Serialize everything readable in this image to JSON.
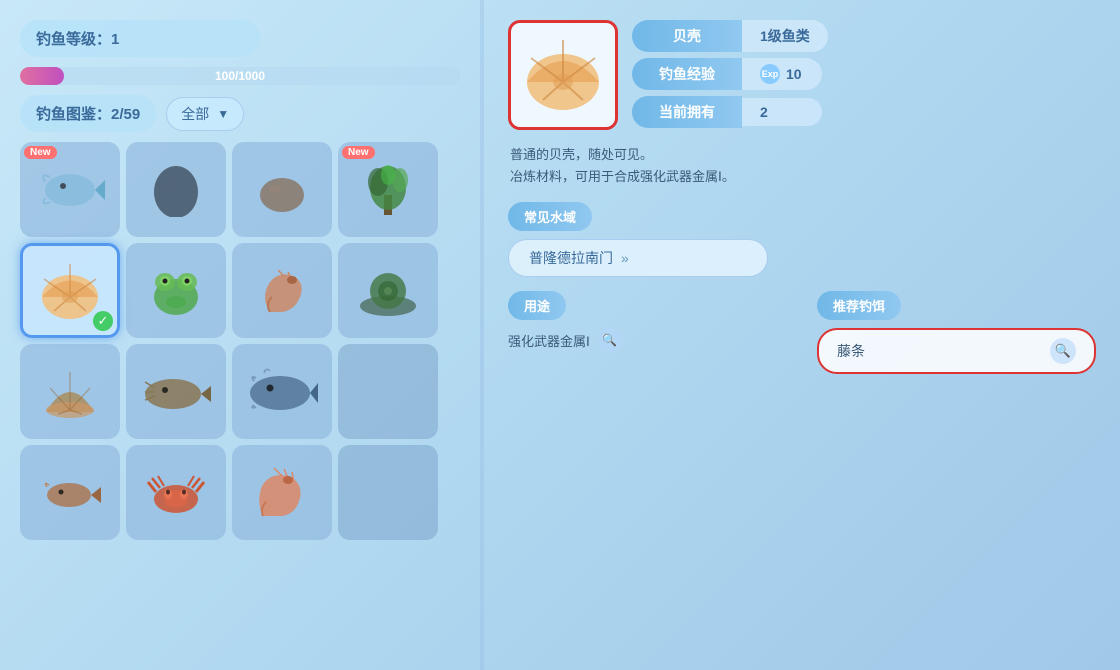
{
  "left": {
    "fishing_level_label": "钓鱼等级：1",
    "exp_current": "100",
    "exp_max": "1000",
    "exp_bar_text": "100/1000",
    "exp_percent": 10,
    "encyclopedia_label": "钓鱼图鉴：2/59",
    "filter_label": "全部",
    "grid": [
      {
        "id": 0,
        "has_new": true,
        "has_fish": true,
        "fish_type": "fish",
        "color": "#aaccee",
        "selected": false,
        "discovered": true
      },
      {
        "id": 1,
        "has_new": false,
        "has_fish": true,
        "fish_type": "egg",
        "color": "#778899",
        "selected": false,
        "discovered": true
      },
      {
        "id": 2,
        "has_new": false,
        "has_fish": true,
        "fish_type": "rock",
        "color": "#998877",
        "selected": false,
        "discovered": true
      },
      {
        "id": 3,
        "has_new": true,
        "has_fish": true,
        "fish_type": "plant",
        "color": "#558855",
        "selected": false,
        "discovered": true
      },
      {
        "id": 4,
        "has_new": false,
        "has_fish": true,
        "fish_type": "shell",
        "color": "#eebb88",
        "selected": true,
        "discovered": true,
        "checked": true
      },
      {
        "id": 5,
        "has_new": false,
        "has_fish": true,
        "fish_type": "frog",
        "color": "#55aa55",
        "selected": false,
        "discovered": true
      },
      {
        "id": 6,
        "has_new": false,
        "has_fish": true,
        "fish_type": "shrimp",
        "color": "#cc8866",
        "selected": false,
        "discovered": true
      },
      {
        "id": 7,
        "has_new": false,
        "has_fish": true,
        "fish_type": "lotus",
        "color": "#447744",
        "selected": false,
        "discovered": true
      },
      {
        "id": 8,
        "has_new": false,
        "has_fish": true,
        "fish_type": "shell2",
        "color": "#aa8855",
        "selected": false,
        "discovered": true
      },
      {
        "id": 9,
        "has_new": false,
        "has_fish": true,
        "fish_type": "catfish",
        "color": "#665544",
        "selected": false,
        "discovered": true
      },
      {
        "id": 10,
        "has_new": false,
        "has_fish": true,
        "fish_type": "bigfish",
        "color": "#557799",
        "selected": false,
        "discovered": true
      },
      {
        "id": 11,
        "has_new": false,
        "has_fish": false,
        "fish_type": "",
        "color": "",
        "selected": false,
        "discovered": false
      },
      {
        "id": 12,
        "has_new": false,
        "has_fish": true,
        "fish_type": "smallfish",
        "color": "#aa7755",
        "selected": false,
        "discovered": true
      },
      {
        "id": 13,
        "has_new": false,
        "has_fish": true,
        "fish_type": "crab",
        "color": "#cc5533",
        "selected": false,
        "discovered": true
      },
      {
        "id": 14,
        "has_new": false,
        "has_fish": true,
        "fish_type": "prawn",
        "color": "#dd8866",
        "selected": false,
        "discovered": true
      },
      {
        "id": 15,
        "has_new": false,
        "has_fish": false,
        "fish_type": "",
        "color": "",
        "selected": false,
        "discovered": false
      }
    ]
  },
  "right": {
    "item_name": "贝壳",
    "item_grade": "1级鱼类",
    "stat1_label": "贝壳",
    "stat1_value": "1级鱼类",
    "stat2_label": "钓鱼经验",
    "stat2_value": "10",
    "stat3_label": "当前拥有",
    "stat3_value": "2",
    "description_line1": "普通的贝壳，随处可见。",
    "description_line2": "冶炼材料，可用于合成强化武器金属Ⅰ。",
    "water_section_label": "常见水域",
    "water_area_name": "普隆德拉南门",
    "use_section_label": "用途",
    "bait_section_label": "推荐钓饵",
    "use_item_name": "强化武器金属Ⅰ",
    "bait_item_name": "藤条",
    "search_icon_label": "🔍"
  }
}
